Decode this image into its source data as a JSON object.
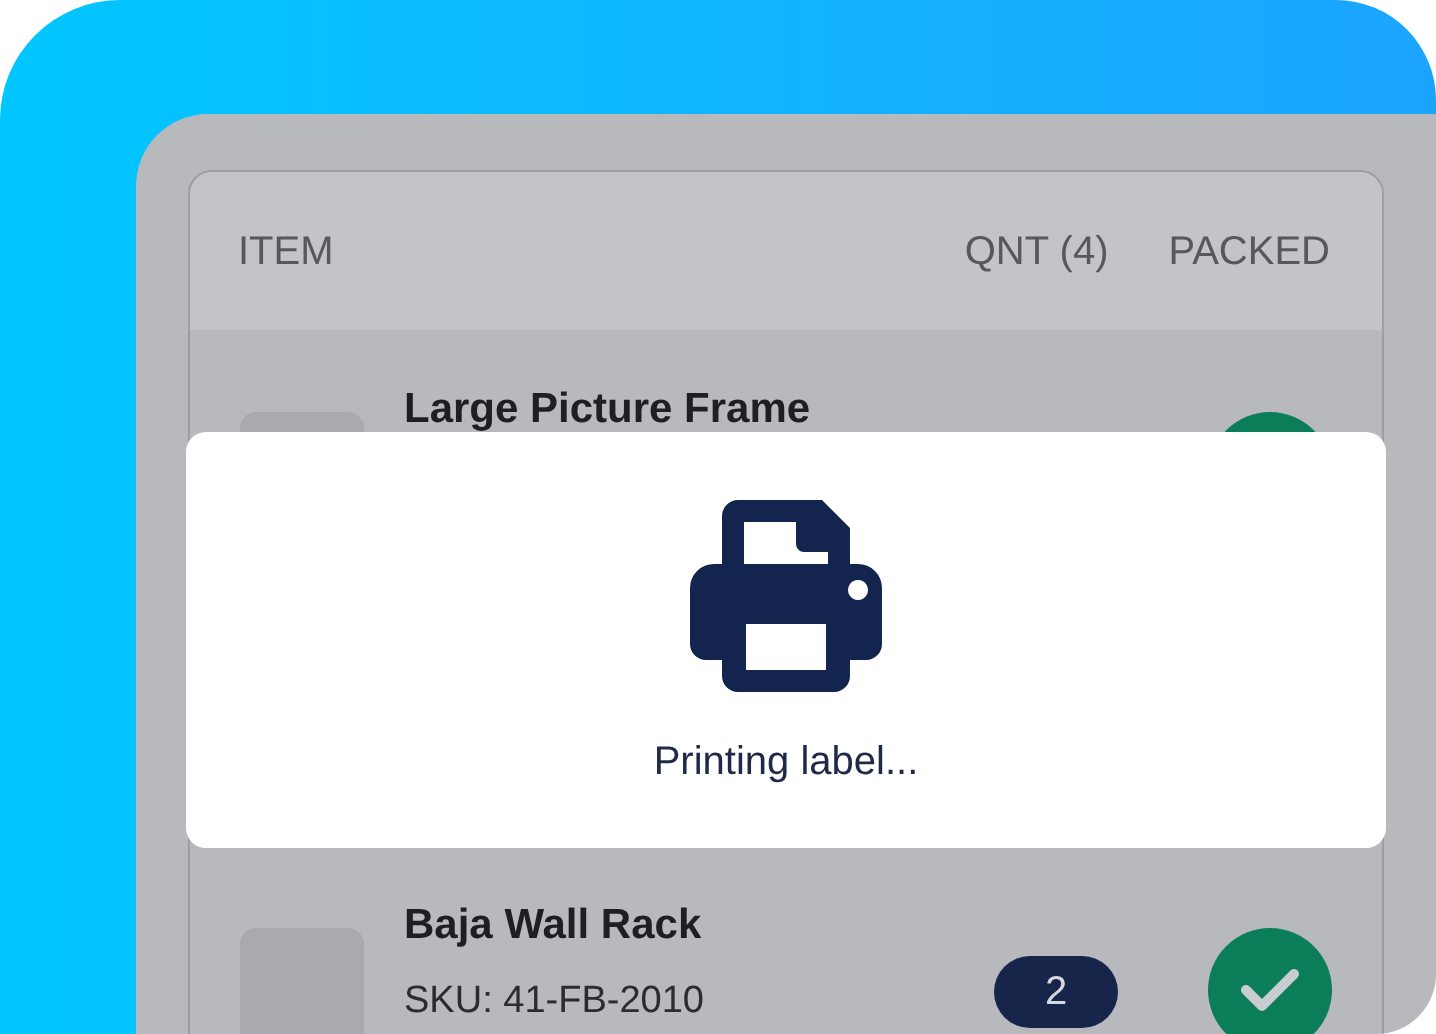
{
  "table": {
    "columns": [
      {
        "label": "ITEM"
      },
      {
        "label": "QNT (4)"
      },
      {
        "label": "PACKED"
      }
    ],
    "rows": [
      {
        "name": "Large Picture Frame",
        "packed": true
      },
      {
        "name": "Baja Wall Rack",
        "sku": "SKU: 41-FB-2010",
        "quantity": "2",
        "packed": true
      }
    ]
  },
  "dialog": {
    "message": "Printing label..."
  }
}
